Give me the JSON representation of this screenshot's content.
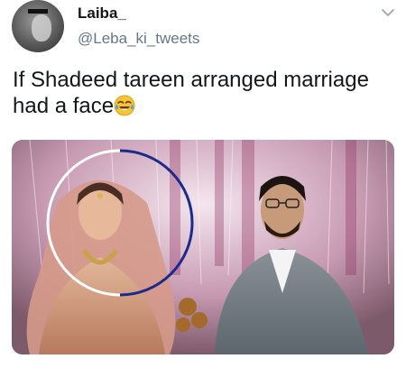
{
  "header": {
    "display_name": "Laiba_",
    "handle": "@Leba_ki_tweets"
  },
  "tweet": {
    "text": "If Shadeed tareen arranged marriage had a face",
    "emoji": "face-with-tears-of-joy-icon"
  },
  "media": {
    "description": "wedding-photo",
    "highlight_circle_colors": [
      "#ffffff",
      "#1c2a8c"
    ]
  },
  "colors": {
    "primary_text": "#14171a",
    "secondary_text": "#657786"
  }
}
